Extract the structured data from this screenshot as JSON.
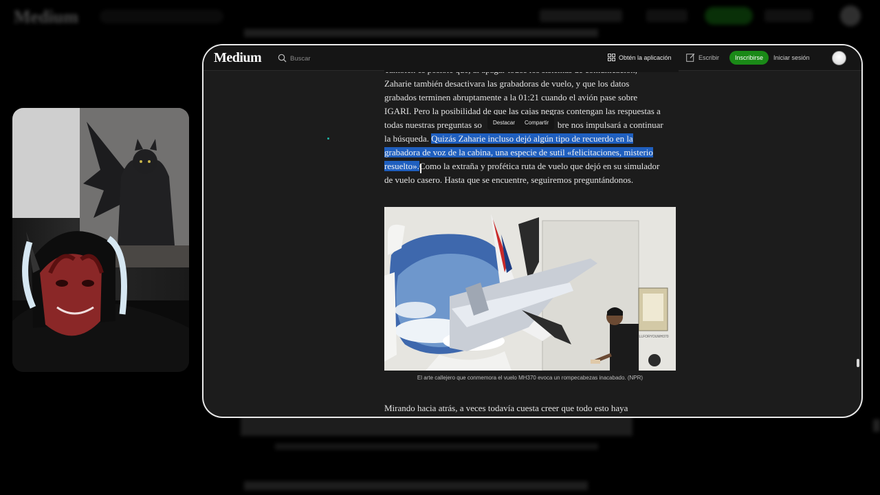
{
  "brand": "Medium",
  "header": {
    "search_placeholder": "Buscar",
    "get_app_label": "Obtén la aplicación",
    "write_label": "Escribir",
    "signup_label": "Inscribirse",
    "login_label": "Iniciar sesión"
  },
  "article": {
    "paragraph1_lines": [
      "También es posible que, al apagar todos los sistemas de comunicación,",
      "Zaharie también desactivara las grabadoras de vuelo, y que los datos",
      "grabados terminen abruptamente a la 01:21 cuando el avión pase sobre",
      "IGARI. Pero la posibilidad de que las cajas negras contengan las respuestas a",
      "todas nuestras preguntas so",
      "bre nos impulsará a continuar",
      "la búsqueda. ",
      "Quizás Zaharie incluso dejó algún tipo de recuerdo en la",
      "grabadora de voz de la cabina, una especie de sutil «felicitaciones, misterio",
      "resuelto».",
      "Como la extraña y profética ruta de vuelo que dejó en su simulador",
      "de vuelo casero. Hasta que se encuentre, seguiremos preguntándonos."
    ],
    "selection_toolbar": {
      "highlight_label": "Destacar",
      "share_label": "Compartir"
    },
    "figure_caption": "El arte callejero que conmemora el vuelo MH370 evoca un rompecabezas inacabado. (NPR)",
    "figure_poster_text": "#STILLFORYOUMH370",
    "paragraph2_start": "Mirando hacia atrás, a veces todavía cuesta creer que todo esto haya"
  },
  "colors": {
    "accent_green": "#1a8917",
    "selection_blue": "#1f5fbf",
    "page_bg": "#1c1c1c"
  },
  "icons": {
    "search": "search-icon",
    "app": "app-grid-icon",
    "write": "write-icon",
    "avatar": "avatar"
  }
}
